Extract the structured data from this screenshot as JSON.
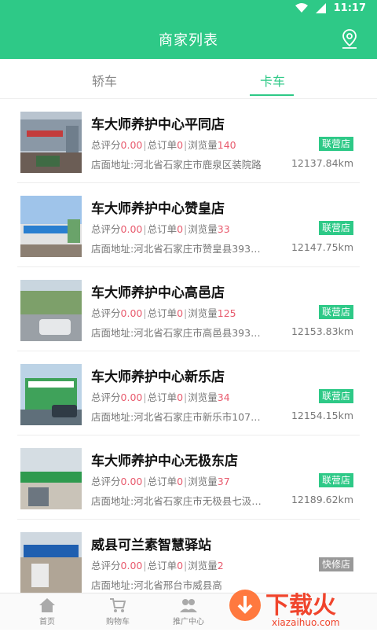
{
  "status_bar": {
    "time": "11:17"
  },
  "header": {
    "title": "商家列表",
    "location_icon": "location-pin-icon"
  },
  "tabs": [
    {
      "label": "轿车",
      "active": false
    },
    {
      "label": "卡车",
      "active": true
    }
  ],
  "labels": {
    "rating": "总评分",
    "orders": "总订单",
    "views": "浏览量",
    "sep": "|"
  },
  "stores": [
    {
      "name": "车大师养护中心平同店",
      "rating": "0.00",
      "orders": "0",
      "views": "140",
      "address": "店面地址:河北省石家庄市鹿泉区装院路",
      "badge": "联营店",
      "distance": "12137.84km"
    },
    {
      "name": "车大师养护中心赞皇店",
      "rating": "0.00",
      "orders": "0",
      "views": "33",
      "address": "店面地址:河北省石家庄市赞皇县393…",
      "badge": "联营店",
      "distance": "12147.75km"
    },
    {
      "name": "车大师养护中心高邑店",
      "rating": "0.00",
      "orders": "0",
      "views": "125",
      "address": "店面地址:河北省石家庄市高邑县393…",
      "badge": "联营店",
      "distance": "12153.83km"
    },
    {
      "name": "车大师养护中心新乐店",
      "rating": "0.00",
      "orders": "0",
      "views": "34",
      "address": "店面地址:河北省石家庄市新乐市107…",
      "badge": "联营店",
      "distance": "12154.15km"
    },
    {
      "name": "车大师养护中心无极东店",
      "rating": "0.00",
      "orders": "0",
      "views": "37",
      "address": "店面地址:河北省石家庄市无极县七汲…",
      "badge": "联营店",
      "distance": "12189.62km"
    },
    {
      "name": "威县可兰素智慧驿站",
      "rating": "0.00",
      "orders": "0",
      "views": "2",
      "address": "店面地址:河北省邢台市威县高",
      "badge": "快修店",
      "distance": ""
    }
  ],
  "bottom_nav": [
    {
      "label": "首页"
    },
    {
      "label": "购物车"
    },
    {
      "label": "推广中心"
    }
  ],
  "watermark": {
    "logo": "下载火",
    "site": "xiazaihuo.com"
  },
  "colors": {
    "brand_green": "#2ec987",
    "number_red": "#e85a6d",
    "badge_grey": "#999999"
  }
}
